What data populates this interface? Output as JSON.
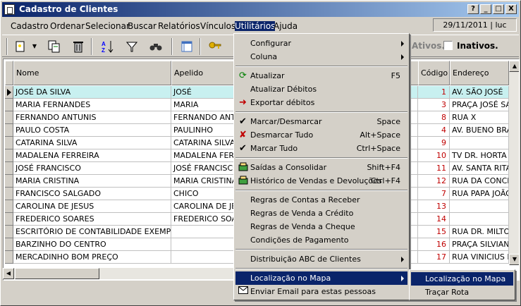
{
  "window": {
    "title": "Cadastro de Clientes",
    "date_user": "29/11/2011 | luc",
    "buttons": [
      "?",
      "_",
      "□",
      "X"
    ]
  },
  "menubar": [
    {
      "label": "Cadastro"
    },
    {
      "label": "Ordenar"
    },
    {
      "label": "Selecionar"
    },
    {
      "label": "Buscar"
    },
    {
      "label": "Relatórios"
    },
    {
      "label": "Vínculos"
    },
    {
      "label": "Utilitários"
    },
    {
      "label": "Ajuda"
    }
  ],
  "filters": {
    "ativos_label": "Ativos.",
    "inativos_label": "Inativos."
  },
  "toolbar_icons": [
    "new-icon",
    "dropdown-arrow-icon",
    "copy-icon",
    "delete-icon",
    "sort-az-icon",
    "filter-icon",
    "binoculars-icon",
    "window-icon",
    "key-icon"
  ],
  "table": {
    "columns": [
      "Nome",
      "Apelido",
      "Código",
      "Endereço"
    ],
    "rows": [
      {
        "nome": "JOSÉ DA SILVA",
        "apelido": "JOSÉ",
        "codigo": "1",
        "endereco": "AV. SÃO JOSÉ"
      },
      {
        "nome": "MARIA FERNANDES",
        "apelido": "MARIA",
        "codigo": "3",
        "endereco": "PRAÇA JOSÉ SA"
      },
      {
        "nome": "FERNANDO ANTUNIS",
        "apelido": "FERNANDO ANTU",
        "codigo": "8",
        "endereco": "RUA X"
      },
      {
        "nome": "PAULO COSTA",
        "apelido": "PAULINHO",
        "codigo": "4",
        "endereco": "AV. BUENO BRAN"
      },
      {
        "nome": "CATARINA SILVA",
        "apelido": "CATARINA SILVA",
        "codigo": "9",
        "endereco": ""
      },
      {
        "nome": "MADALENA FERREIRA",
        "apelido": "MADALENA FERR",
        "codigo": "10",
        "endereco": "TV DR. HORTA"
      },
      {
        "nome": "JOSÉ FRANCISCO",
        "apelido": "JOSÉ FRANCISCO",
        "codigo": "11",
        "endereco": "AV. SANTA RITA"
      },
      {
        "nome": "MARIA CRISTINA",
        "apelido": "MARIA CRISTINA",
        "codigo": "12",
        "endereco": "RUA DA CONCEI"
      },
      {
        "nome": "FRANCISCO SALGADO",
        "apelido": "CHICO",
        "codigo": "7",
        "endereco": "RUA PAPA JOÃO"
      },
      {
        "nome": "CAROLINA DE JESUS",
        "apelido": "CAROLINA DE JES",
        "codigo": "13",
        "endereco": ""
      },
      {
        "nome": "FREDERICO SOARES",
        "apelido": "FREDERICO SOAR",
        "codigo": "14",
        "endereco": ""
      },
      {
        "nome": "ESCRITÓRIO DE CONTABILIDADE EXEMPLO",
        "apelido": "",
        "codigo": "15",
        "endereco": "RUA DR. MILTON"
      },
      {
        "nome": "BARZINHO DO CENTRO",
        "apelido": "",
        "codigo": "16",
        "endereco": "PRAÇA SILVIANO"
      },
      {
        "nome": "MERCADINHO BOM PREÇO",
        "apelido": "",
        "codigo": "17",
        "endereco": "RUA VINICIUS D"
      }
    ]
  },
  "utilitarios_menu": [
    {
      "label": "Configurar",
      "submenu": true
    },
    {
      "label": "Coluna",
      "submenu": true
    },
    {
      "label": "Atualizar",
      "shortcut": "F5",
      "icon": "refresh-icon"
    },
    {
      "label": "Atualizar Débitos"
    },
    {
      "label": "Exportar débitos",
      "icon": "export-icon"
    },
    {
      "label": "Marcar/Desmarcar",
      "shortcut": "Space",
      "icon": "check-icon"
    },
    {
      "label": "Desmarcar Tudo",
      "shortcut": "Alt+Space",
      "icon": "uncheck-icon"
    },
    {
      "label": "Marcar Tudo",
      "shortcut": "Ctrl+Space",
      "icon": "check-all-icon"
    },
    {
      "label": "Saídas a Consolidar",
      "shortcut": "Shift+F4",
      "icon": "cash-register-icon"
    },
    {
      "label": "Histórico de Vendas e Devoluções",
      "shortcut": "Ctrl+F4",
      "icon": "cash-register-icon"
    },
    {
      "label": "Regras de Contas a Receber"
    },
    {
      "label": "Regras de Venda a Crédito"
    },
    {
      "label": "Regras de Venda a Cheque"
    },
    {
      "label": "Condições de Pagamento"
    },
    {
      "label": "Distribuição ABC de Clientes",
      "submenu": true
    },
    {
      "label": "Localização no Mapa",
      "submenu": true
    },
    {
      "label": "Enviar Email para estas pessoas",
      "icon": "email-icon"
    }
  ],
  "localizacao_submenu": [
    {
      "label": "Localização no Mapa"
    },
    {
      "label": "Traçar Rota"
    }
  ],
  "colors": {
    "title_start": "#0a246a",
    "title_end": "#a6caf0",
    "highlight": "#0a246a",
    "selected_row": "#c8f0f0",
    "code_red": "#c00000"
  }
}
